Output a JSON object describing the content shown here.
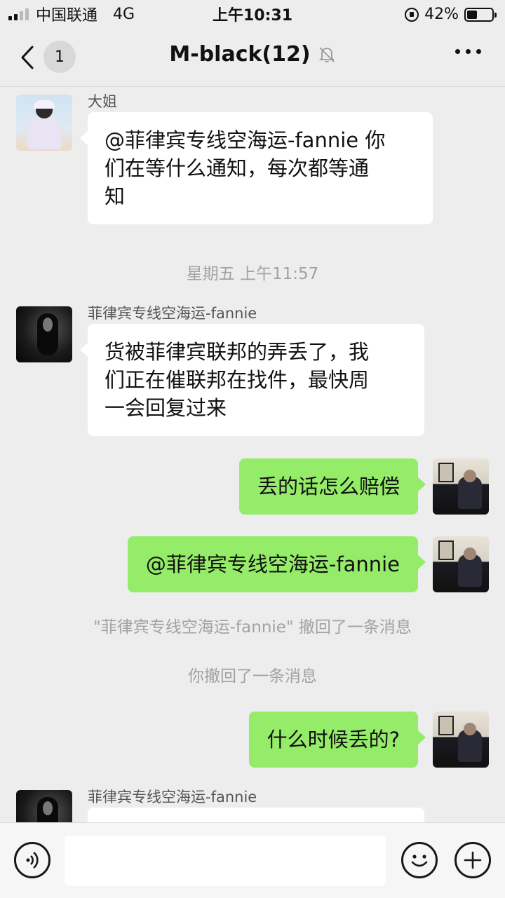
{
  "status_bar": {
    "carrier": "中国联通",
    "network": "4G",
    "time": "上午10:31",
    "battery_percent": "42%",
    "battery_level": 0.42
  },
  "header": {
    "unread_count": "1",
    "title": "M-black(12)",
    "muted": true
  },
  "messages": [
    {
      "sender": "大姐",
      "text": "@菲律宾专线空海运-fannie 你们在等什么通知，每次都等通知",
      "lines": [
        "@菲律宾专线空海运-fannie 你",
        "们在等什么通知，每次都等通",
        "知"
      ]
    },
    {
      "system": "星期五 上午11:57"
    },
    {
      "sender": "菲律宾专线空海运-fannie",
      "text": "货被菲律宾联邦的弄丢了，我们正在催联邦在找件，最快周一会回复过来",
      "lines": [
        "货被菲律宾联邦的弄丢了，我",
        "们正在催联邦在找件，最快周",
        "一会回复过来"
      ]
    },
    {
      "self": true,
      "text": "丢的话怎么赔偿"
    },
    {
      "self": true,
      "text": "@菲律宾专线空海运-fannie"
    },
    {
      "system": "\"菲律宾专线空海运-fannie\" 撤回了一条消息"
    },
    {
      "system": "你撤回了一条消息"
    },
    {
      "self": true,
      "text": "什么时候丢的?"
    },
    {
      "sender": "菲律宾专线空海运-fannie",
      "text": ""
    }
  ],
  "input": {
    "placeholder": ""
  },
  "icons": {
    "back": "chevron-left-icon",
    "mute": "bell-off-icon",
    "more": "more-dots-icon",
    "voice": "voice-icon",
    "emoji": "emoji-icon",
    "plus": "plus-icon"
  },
  "colors": {
    "background": "#ededed",
    "self_bubble": "#95ec69",
    "other_bubble": "#ffffff",
    "system_text": "#a2a2a2"
  }
}
